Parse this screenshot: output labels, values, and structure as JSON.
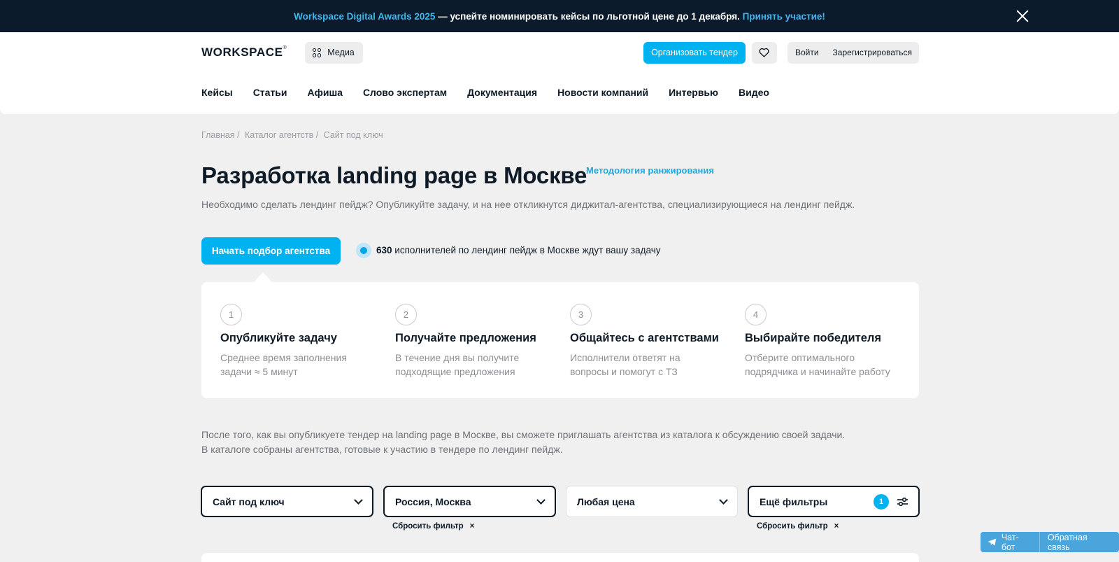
{
  "banner": {
    "highlight": "Workspace Digital Awards 2025",
    "text": " — успейте номинировать кейсы по льготной цене до 1 декабря. ",
    "link": "Принять участие!"
  },
  "header": {
    "logo": "WORKSPACE",
    "logo_mark": "®",
    "media_label": "Медиа",
    "tender_label": "Организовать тендер",
    "login_label": "Войти",
    "register_label": "Зарегистрироваться"
  },
  "nav": [
    "Кейсы",
    "Статьи",
    "Афиша",
    "Слово экспертам",
    "Документация",
    "Новости компаний",
    "Интервью",
    "Видео"
  ],
  "breadcrumbs": [
    "Главная /",
    "Каталог агентств /",
    "Сайт под ключ"
  ],
  "page": {
    "title": "Разработка landing page в Москве",
    "method_link": "Методология ранжирования",
    "subtitle": "Необходимо сделать лендинг пейдж? Опубликуйте задачу, и на нее откликнутся диджитал-агентства, специализирующиеся на лендинг пейдж.",
    "cta_label": "Начать подбор агентства",
    "exec_count": "630",
    "exec_text": " исполнителей по лендинг пейдж в Москве ждут вашу задачу"
  },
  "steps": [
    {
      "num": "1",
      "title": "Опубликуйте задачу",
      "desc": "Среднее время заполнения задачи ≈ 5 минут"
    },
    {
      "num": "2",
      "title": "Получайте предложения",
      "desc": "В течение дня вы получите подходящие предложения"
    },
    {
      "num": "3",
      "title": "Общайтесь с агентствами",
      "desc": "Исполнители ответят на вопросы и помогут с ТЗ"
    },
    {
      "num": "4",
      "title": "Выбирайте победителя",
      "desc": "Отберите оптимального подрядчика и начинайте работу"
    }
  ],
  "info": {
    "line1": "После того, как вы опубликуете тендер на landing page в Москве, вы сможете приглашать агентства из каталога к обсуждению своей задачи.",
    "line2": "В каталоге собраны агентства, готовые к участию в тендере по лендинг пейдж."
  },
  "filters": {
    "service": "Сайт под ключ",
    "location": "Россия, Москва",
    "price": "Любая цена",
    "more": "Ещё фильтры",
    "more_count": "1",
    "reset_label": "Сбросить фильтр",
    "reset_x": "×"
  },
  "widget": {
    "chatbot": "Чат-бот",
    "feedback": "Обратная связь"
  }
}
